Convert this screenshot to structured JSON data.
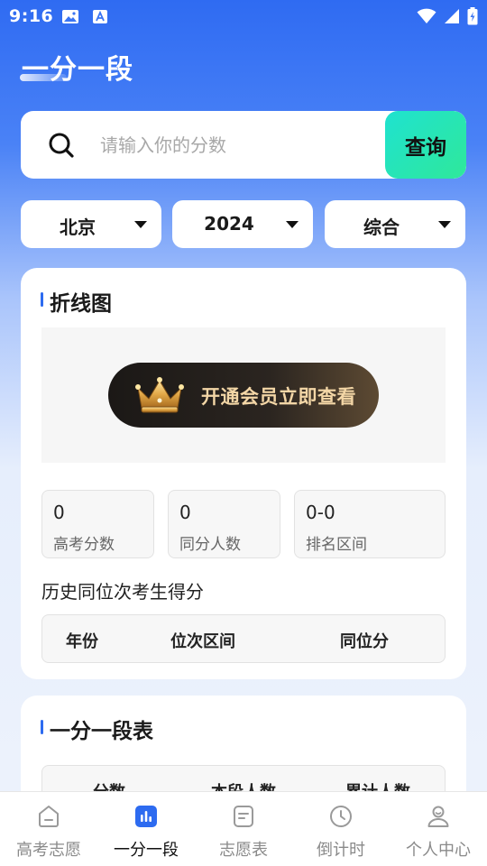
{
  "status_bar": {
    "time": "9:16"
  },
  "header": {
    "title": "一分一段"
  },
  "search": {
    "placeholder": "请输入你的分数",
    "value": "",
    "button_label": "查询"
  },
  "filters": [
    {
      "label": "北京"
    },
    {
      "label": "2024"
    },
    {
      "label": "综合"
    }
  ],
  "line_chart_card": {
    "title": "折线图",
    "vip_label": "开通会员立即查看",
    "stats": [
      {
        "value": "0",
        "label": "高考分数"
      },
      {
        "value": "0",
        "label": "同分人数"
      },
      {
        "value": "0-0",
        "label": "排名区间"
      }
    ],
    "history_title": "历史同位次考生得分",
    "history_columns": [
      "年份",
      "位次区间",
      "同位分"
    ]
  },
  "segment_table_card": {
    "title": "一分一段表",
    "columns": [
      "分数",
      "本段人数",
      "累计人数"
    ]
  },
  "bottom_nav": [
    {
      "label": "高考志愿",
      "icon": "home-icon"
    },
    {
      "label": "一分一段",
      "icon": "bar-chart-icon"
    },
    {
      "label": "志愿表",
      "icon": "document-icon"
    },
    {
      "label": "倒计时",
      "icon": "clock-icon"
    },
    {
      "label": "个人中心",
      "icon": "person-icon"
    }
  ],
  "colors": {
    "accent": "#2d6bf0",
    "search_button": "#22e6b8",
    "vip_text": "#f3d6a6"
  }
}
